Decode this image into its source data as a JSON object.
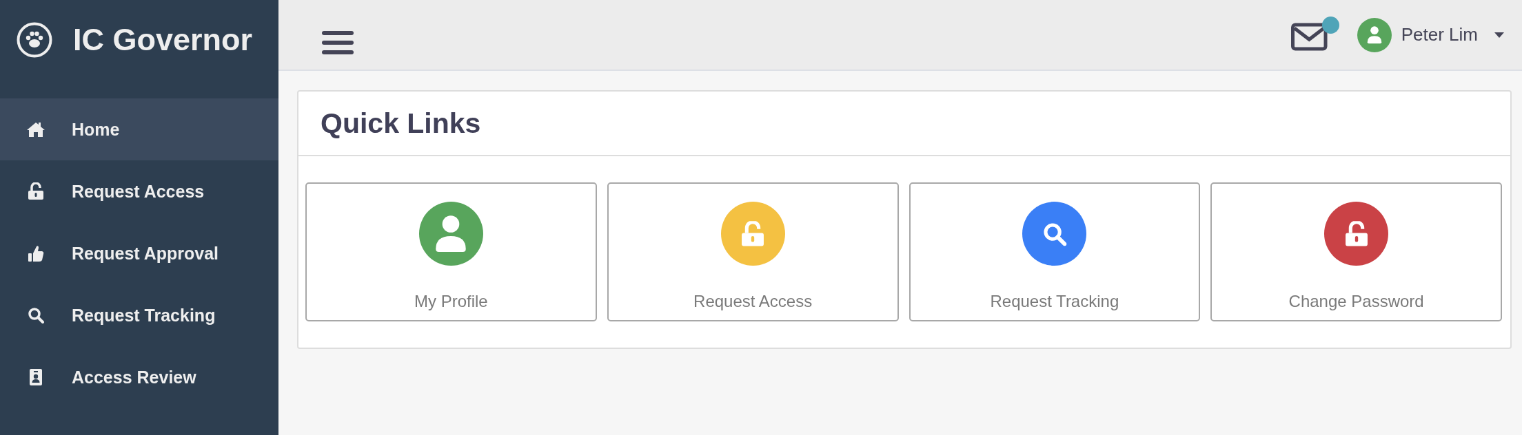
{
  "sidebar": {
    "brand": "IC Governor",
    "items": [
      {
        "label": "Home",
        "kind": "home",
        "selected": true
      },
      {
        "label": "Request Access",
        "kind": "unlock",
        "selected": false
      },
      {
        "label": "Request Approval",
        "kind": "thumb",
        "selected": false
      },
      {
        "label": "Request Tracking",
        "kind": "search",
        "selected": false
      },
      {
        "label": "Access Review",
        "kind": "badge",
        "selected": false
      }
    ]
  },
  "header": {
    "messages": {
      "unread": true
    },
    "user": {
      "name": "Peter Lim"
    }
  },
  "panel": {
    "title": "Quick Links",
    "links": [
      {
        "label": "My Profile",
        "kind": "user",
        "color": "#58a55c"
      },
      {
        "label": "Request Access",
        "kind": "unlock",
        "color": "#f4c142"
      },
      {
        "label": "Request Tracking",
        "kind": "search",
        "color": "#3a7ff6"
      },
      {
        "label": "Change Password",
        "kind": "unlock",
        "color": "#ca4246"
      }
    ]
  }
}
